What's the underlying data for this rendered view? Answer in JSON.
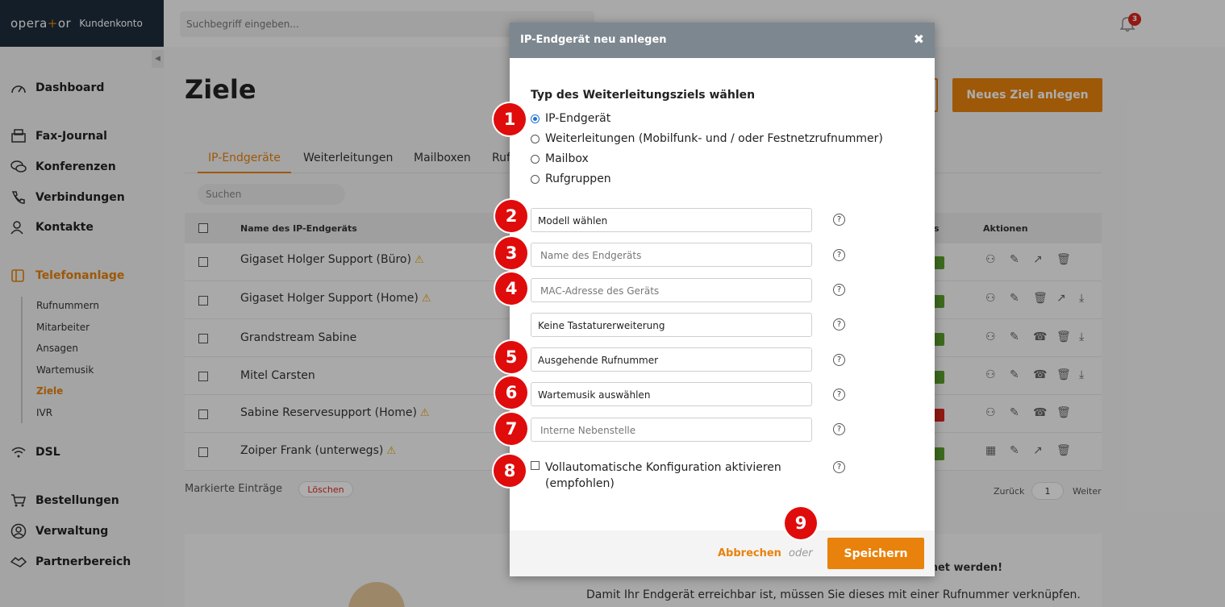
{
  "app": {
    "brand_left": "opera",
    "brand_plus": "+",
    "brand_right": "or",
    "subtitle": "Kundenkonto"
  },
  "topbar": {
    "search_placeholder": "Suchbegriff eingeben...",
    "notification_count": "3"
  },
  "sidebar": {
    "items": [
      {
        "label": "Dashboard",
        "icon": "dashboard-icon"
      },
      {
        "label": "Fax-Journal",
        "icon": "fax-icon"
      },
      {
        "label": "Konferenzen",
        "icon": "conference-icon"
      },
      {
        "label": "Verbindungen",
        "icon": "phone-icon"
      },
      {
        "label": "Kontakte",
        "icon": "contacts-icon"
      },
      {
        "label": "Telefonanlage",
        "icon": "phone-system-icon"
      },
      {
        "label": "DSL",
        "icon": "wifi-icon"
      },
      {
        "label": "Bestellungen",
        "icon": "cart-icon"
      },
      {
        "label": "Verwaltung",
        "icon": "user-icon"
      },
      {
        "label": "Partnerbereich",
        "icon": "handshake-icon"
      }
    ],
    "subitems": [
      "Rufnummern",
      "Mitarbeiter",
      "Ansagen",
      "Wartemusik",
      "Ziele",
      "IVR"
    ]
  },
  "main": {
    "title": "Ziele",
    "new_button": "Neues Ziel anlegen",
    "tabs": [
      "IP-Endgeräte",
      "Weiterleitungen",
      "Mailboxen",
      "Ruf"
    ],
    "search_placeholder": "Suchen",
    "columns": {
      "name": "Name des IP-Endgeräts",
      "status": "s",
      "actions": "Aktionen"
    },
    "rows": [
      {
        "name": "Gigaset Holger Support (Büro)",
        "warning": true,
        "status_color": "#5aa02c"
      },
      {
        "name": "Gigaset Holger Support (Home)",
        "warning": true,
        "status_color": "#5aa02c"
      },
      {
        "name": "Grandstream Sabine",
        "warning": false,
        "status_color": "#5aa02c"
      },
      {
        "name": "Mitel Carsten",
        "warning": false,
        "status_color": "#5aa02c"
      },
      {
        "name": "Sabine Reservesupport (Home)",
        "warning": true,
        "status_color": "#d9261c"
      },
      {
        "name": "Zoiper Frank (unterwegs)",
        "warning": true,
        "status_color": "#5aa02c"
      }
    ],
    "marked_label": "Markierte Einträge",
    "delete_label": "Löschen",
    "pager": {
      "prev": "Zurück",
      "page": "1",
      "next": "Weiter"
    },
    "info_title": "rdnet werden!",
    "info_text": "Damit Ihr Endgerät erreichbar ist, müssen Sie dieses mit einer Rufnummer verknüpfen."
  },
  "modal": {
    "title": "IP-Endgerät neu anlegen",
    "close": "✖",
    "section_title": "Typ des Weiterleitungsziels wählen",
    "options": [
      {
        "label": "IP-Endgerät",
        "selected": true
      },
      {
        "label": "Weiterleitungen (Mobilfunk- und / oder Festnetzrufnummer)",
        "selected": false
      },
      {
        "label": "Mailbox",
        "selected": false
      },
      {
        "label": "Rufgruppen",
        "selected": false
      }
    ],
    "fields": {
      "model": "Modell wählen",
      "device_name_placeholder": "Name des Endgeräts",
      "mac_placeholder": "MAC-Adresse des Geräts",
      "keyboard": "Keine Tastaturerweiterung",
      "outgoing": "Ausgehende Rufnummer",
      "music": "Wartemusik auswählen",
      "extension_placeholder": "Interne Nebenstelle"
    },
    "auto_config_label": "Vollautomatische Konfiguration aktivieren (empfohlen)",
    "help_glyph": "?",
    "cancel": "Abbrechen",
    "or": "oder",
    "save": "Speichern"
  },
  "markers": [
    "1",
    "2",
    "3",
    "4",
    "5",
    "6",
    "7",
    "8",
    "9"
  ],
  "colors": {
    "accent": "#e8820c",
    "marker": "#e00b0b",
    "header": "#7d8790",
    "nav_dark": "#1e2d3d"
  }
}
